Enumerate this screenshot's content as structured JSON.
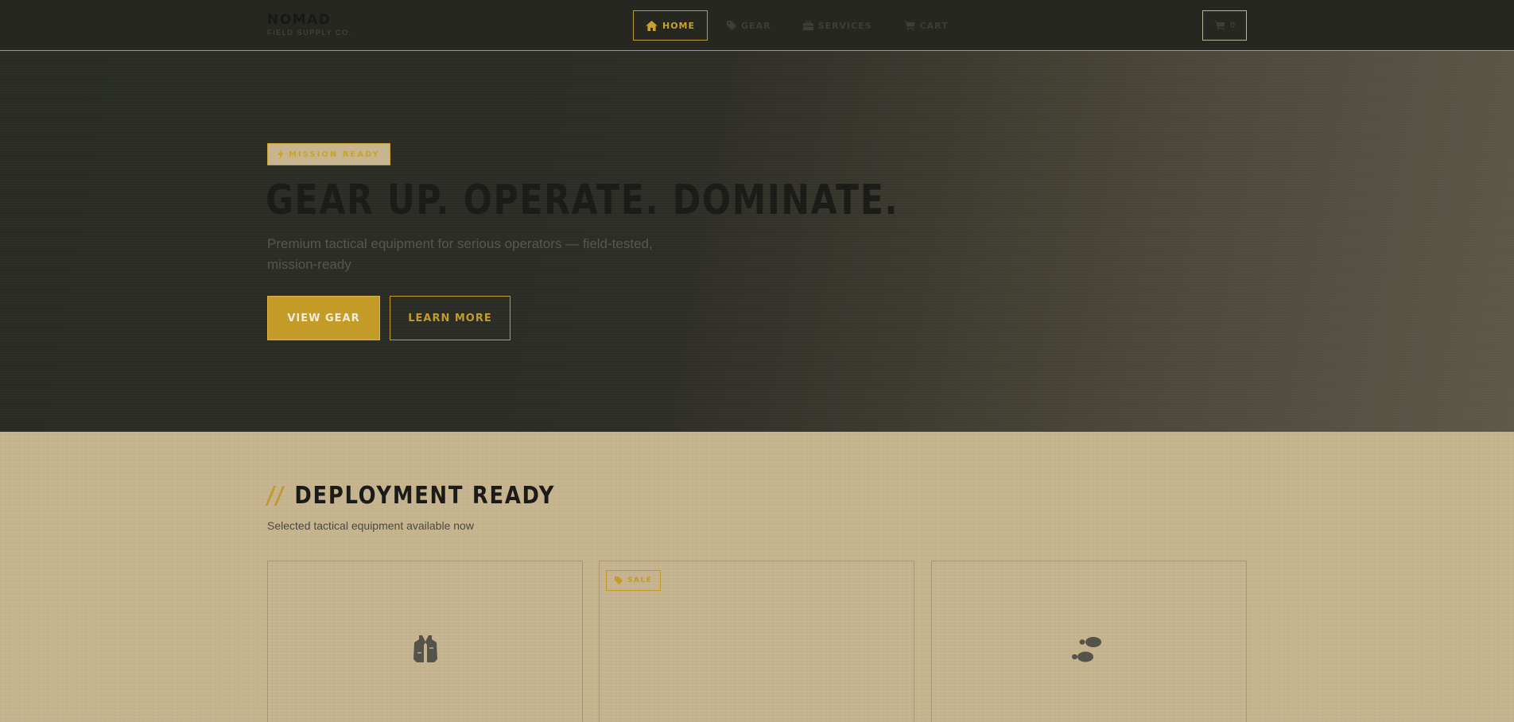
{
  "brand": {
    "name": "NOMAD",
    "tagline": "FIELD SUPPLY CO."
  },
  "nav": {
    "items": [
      {
        "label": "HOME",
        "icon": "home-icon",
        "active": true
      },
      {
        "label": "GEAR",
        "icon": "tag-icon",
        "active": false
      },
      {
        "label": "SERVICES",
        "icon": "toolbox-icon",
        "active": false
      },
      {
        "label": "CART",
        "icon": "cart-icon",
        "active": false
      }
    ],
    "cart_count": "0"
  },
  "hero": {
    "badge": "MISSION READY",
    "title": "GEAR UP. OPERATE. DOMINATE.",
    "subtitle": "Premium tactical equipment for serious operators — field-tested, mission-ready",
    "primary_cta": "VIEW GEAR",
    "secondary_cta": "LEARN MORE"
  },
  "products": {
    "title_prefix": "//",
    "title": "DEPLOYMENT READY",
    "subtitle": "Selected tactical equipment available now",
    "cards": [
      {
        "icon": "vest-icon",
        "badge": ""
      },
      {
        "icon": "",
        "badge": "SALE"
      },
      {
        "icon": "footprints-icon",
        "badge": ""
      }
    ]
  },
  "colors": {
    "accent": "#c49b26",
    "nav_bg": "#262721",
    "section_bg": "#c7b590"
  }
}
